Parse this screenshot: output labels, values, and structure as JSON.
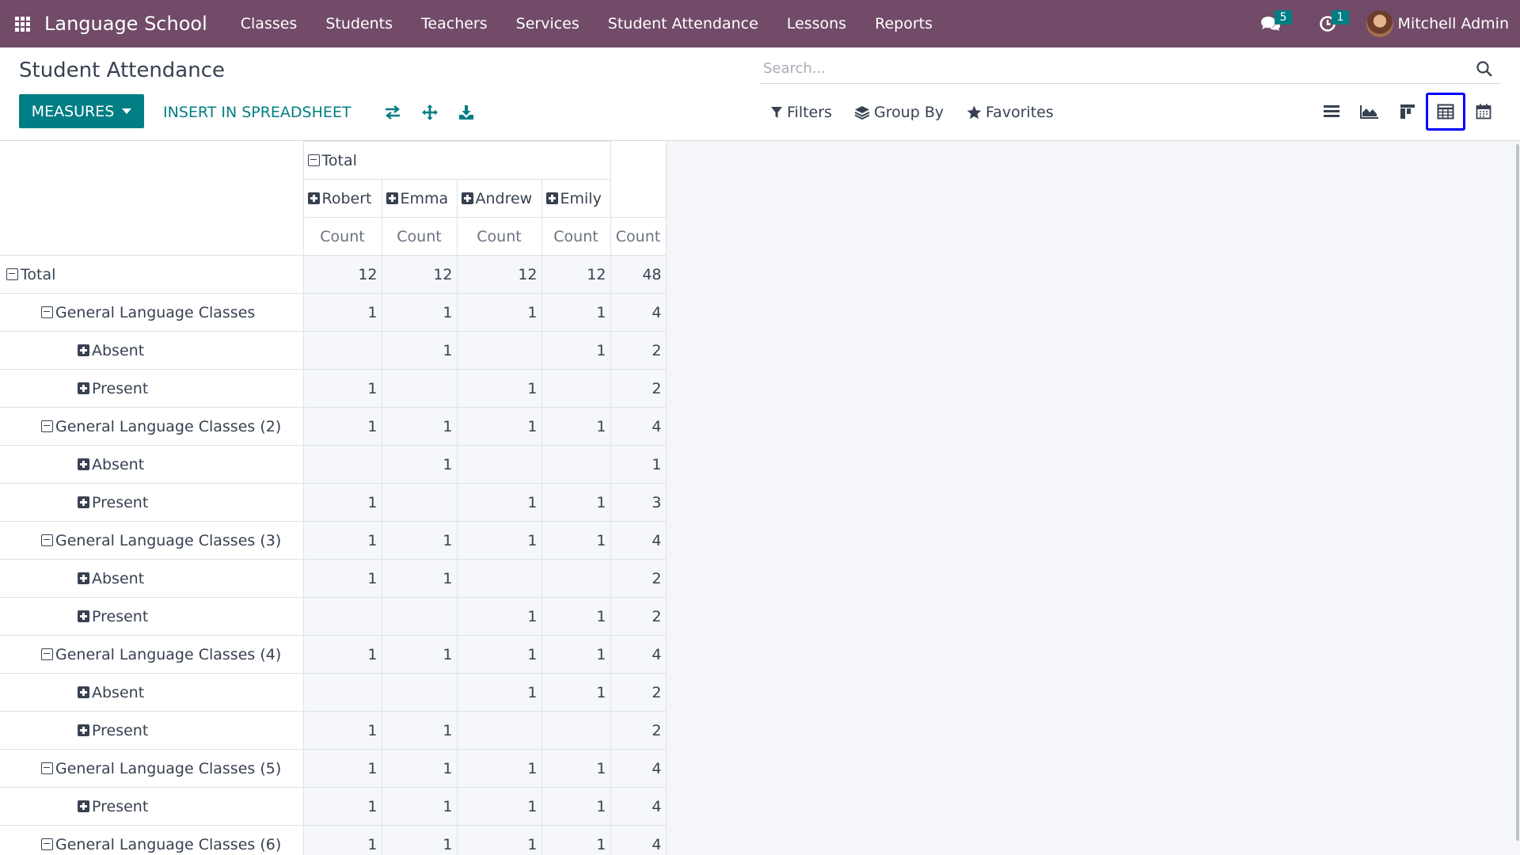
{
  "navbar": {
    "brand": "Language School",
    "menu": [
      "Classes",
      "Students",
      "Teachers",
      "Services",
      "Student Attendance",
      "Lessons",
      "Reports"
    ],
    "messages_count": "5",
    "activities_count": "1",
    "user_name": "Mitchell Admin"
  },
  "control_panel": {
    "title": "Student Attendance",
    "search_placeholder": "Search...",
    "measures_label": "MEASURES",
    "insert_label": "INSERT IN SPREADSHEET",
    "filters_label": "Filters",
    "group_by_label": "Group By",
    "favorites_label": "Favorites",
    "active_view": "pivot"
  },
  "pivot": {
    "col_total_label": "Total",
    "columns": [
      "Robert",
      "Emma",
      "Andrew",
      "Emily"
    ],
    "measure_label": "Count",
    "rows": [
      {
        "label": "Total",
        "level": 0,
        "icon": "minus",
        "values": [
          "12",
          "12",
          "12",
          "12",
          "48"
        ]
      },
      {
        "label": "General Language Classes",
        "level": 1,
        "icon": "minus",
        "values": [
          "1",
          "1",
          "1",
          "1",
          "4"
        ]
      },
      {
        "label": "Absent",
        "level": 2,
        "icon": "plus",
        "values": [
          "",
          "1",
          "",
          "1",
          "2"
        ]
      },
      {
        "label": "Present",
        "level": 2,
        "icon": "plus",
        "values": [
          "1",
          "",
          "1",
          "",
          "2"
        ]
      },
      {
        "label": "General Language Classes (2)",
        "level": 1,
        "icon": "minus",
        "values": [
          "1",
          "1",
          "1",
          "1",
          "4"
        ]
      },
      {
        "label": "Absent",
        "level": 2,
        "icon": "plus",
        "values": [
          "",
          "1",
          "",
          "",
          "1"
        ]
      },
      {
        "label": "Present",
        "level": 2,
        "icon": "plus",
        "values": [
          "1",
          "",
          "1",
          "1",
          "3"
        ]
      },
      {
        "label": "General Language Classes (3)",
        "level": 1,
        "icon": "minus",
        "values": [
          "1",
          "1",
          "1",
          "1",
          "4"
        ]
      },
      {
        "label": "Absent",
        "level": 2,
        "icon": "plus",
        "values": [
          "1",
          "1",
          "",
          "",
          "2"
        ]
      },
      {
        "label": "Present",
        "level": 2,
        "icon": "plus",
        "values": [
          "",
          "",
          "1",
          "1",
          "2"
        ]
      },
      {
        "label": "General Language Classes (4)",
        "level": 1,
        "icon": "minus",
        "values": [
          "1",
          "1",
          "1",
          "1",
          "4"
        ]
      },
      {
        "label": "Absent",
        "level": 2,
        "icon": "plus",
        "values": [
          "",
          "",
          "1",
          "1",
          "2"
        ]
      },
      {
        "label": "Present",
        "level": 2,
        "icon": "plus",
        "values": [
          "1",
          "1",
          "",
          "",
          "2"
        ]
      },
      {
        "label": "General Language Classes (5)",
        "level": 1,
        "icon": "minus",
        "values": [
          "1",
          "1",
          "1",
          "1",
          "4"
        ]
      },
      {
        "label": "Present",
        "level": 2,
        "icon": "plus",
        "values": [
          "1",
          "1",
          "1",
          "1",
          "4"
        ]
      },
      {
        "label": "General Language Classes (6)",
        "level": 1,
        "icon": "minus",
        "values": [
          "1",
          "1",
          "1",
          "1",
          "4"
        ]
      }
    ]
  }
}
